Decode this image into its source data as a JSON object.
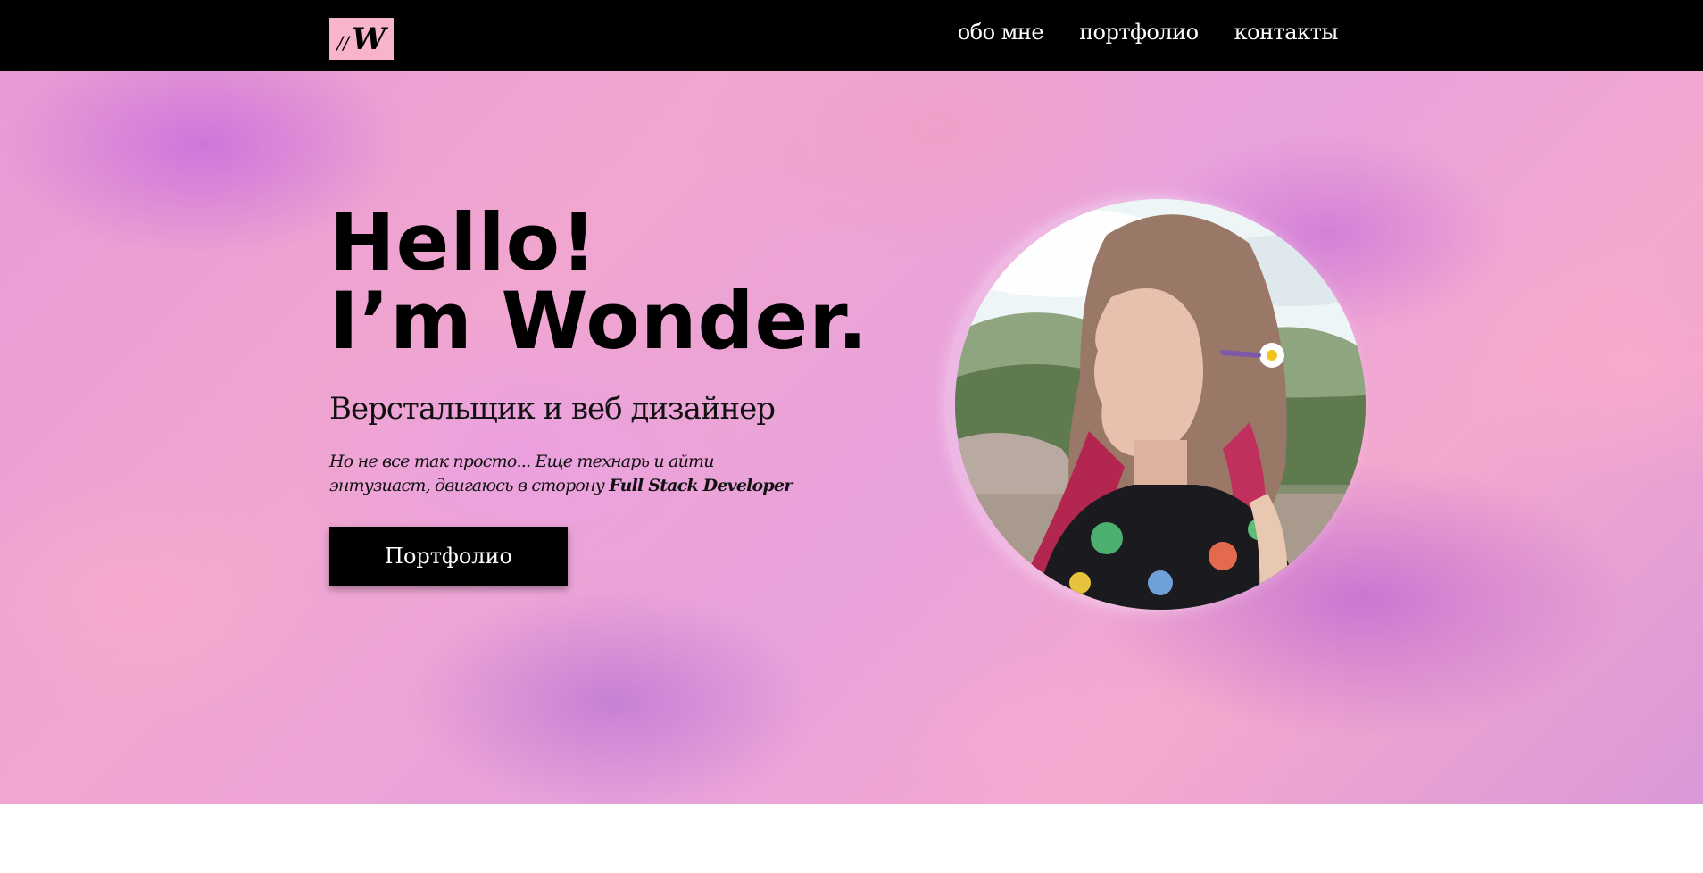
{
  "header": {
    "logo": {
      "slashes": "//",
      "letter": "W"
    },
    "nav": [
      {
        "label": "обо мне"
      },
      {
        "label": "портфолио"
      },
      {
        "label": "контакты"
      }
    ]
  },
  "hero": {
    "greeting_line1": "Hello!",
    "greeting_line2": "I’m Wonder.",
    "role": "Верстальщик и веб дизайнер",
    "description_part1": "Но не все так просто... Еще технарь и айти энтузиаст, двигаюсь в сторону ",
    "description_bold": "Full Stack Developer",
    "cta_label": "Портфолио"
  },
  "colors": {
    "header_bg": "#000000",
    "logo_bg": "#f8b4c8",
    "hero_base": "#f0a6cf",
    "button_bg": "#000000"
  },
  "icons": {
    "avatar": "profile-photo"
  }
}
